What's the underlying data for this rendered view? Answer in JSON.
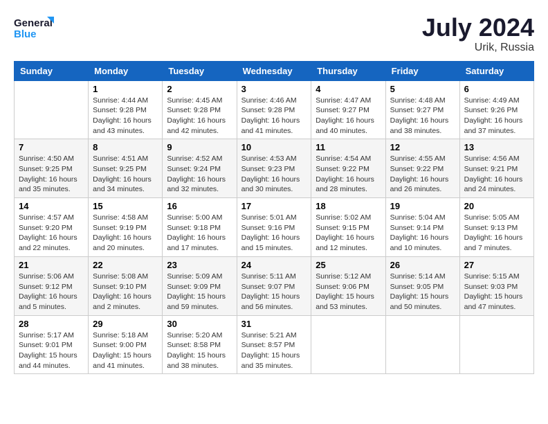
{
  "header": {
    "logo_general": "General",
    "logo_blue": "Blue",
    "month_year": "July 2024",
    "location": "Urik, Russia"
  },
  "days_of_week": [
    "Sunday",
    "Monday",
    "Tuesday",
    "Wednesday",
    "Thursday",
    "Friday",
    "Saturday"
  ],
  "weeks": [
    [
      {
        "day": "",
        "info": ""
      },
      {
        "day": "1",
        "info": "Sunrise: 4:44 AM\nSunset: 9:28 PM\nDaylight: 16 hours\nand 43 minutes."
      },
      {
        "day": "2",
        "info": "Sunrise: 4:45 AM\nSunset: 9:28 PM\nDaylight: 16 hours\nand 42 minutes."
      },
      {
        "day": "3",
        "info": "Sunrise: 4:46 AM\nSunset: 9:28 PM\nDaylight: 16 hours\nand 41 minutes."
      },
      {
        "day": "4",
        "info": "Sunrise: 4:47 AM\nSunset: 9:27 PM\nDaylight: 16 hours\nand 40 minutes."
      },
      {
        "day": "5",
        "info": "Sunrise: 4:48 AM\nSunset: 9:27 PM\nDaylight: 16 hours\nand 38 minutes."
      },
      {
        "day": "6",
        "info": "Sunrise: 4:49 AM\nSunset: 9:26 PM\nDaylight: 16 hours\nand 37 minutes."
      }
    ],
    [
      {
        "day": "7",
        "info": "Sunrise: 4:50 AM\nSunset: 9:25 PM\nDaylight: 16 hours\nand 35 minutes."
      },
      {
        "day": "8",
        "info": "Sunrise: 4:51 AM\nSunset: 9:25 PM\nDaylight: 16 hours\nand 34 minutes."
      },
      {
        "day": "9",
        "info": "Sunrise: 4:52 AM\nSunset: 9:24 PM\nDaylight: 16 hours\nand 32 minutes."
      },
      {
        "day": "10",
        "info": "Sunrise: 4:53 AM\nSunset: 9:23 PM\nDaylight: 16 hours\nand 30 minutes."
      },
      {
        "day": "11",
        "info": "Sunrise: 4:54 AM\nSunset: 9:22 PM\nDaylight: 16 hours\nand 28 minutes."
      },
      {
        "day": "12",
        "info": "Sunrise: 4:55 AM\nSunset: 9:22 PM\nDaylight: 16 hours\nand 26 minutes."
      },
      {
        "day": "13",
        "info": "Sunrise: 4:56 AM\nSunset: 9:21 PM\nDaylight: 16 hours\nand 24 minutes."
      }
    ],
    [
      {
        "day": "14",
        "info": "Sunrise: 4:57 AM\nSunset: 9:20 PM\nDaylight: 16 hours\nand 22 minutes."
      },
      {
        "day": "15",
        "info": "Sunrise: 4:58 AM\nSunset: 9:19 PM\nDaylight: 16 hours\nand 20 minutes."
      },
      {
        "day": "16",
        "info": "Sunrise: 5:00 AM\nSunset: 9:18 PM\nDaylight: 16 hours\nand 17 minutes."
      },
      {
        "day": "17",
        "info": "Sunrise: 5:01 AM\nSunset: 9:16 PM\nDaylight: 16 hours\nand 15 minutes."
      },
      {
        "day": "18",
        "info": "Sunrise: 5:02 AM\nSunset: 9:15 PM\nDaylight: 16 hours\nand 12 minutes."
      },
      {
        "day": "19",
        "info": "Sunrise: 5:04 AM\nSunset: 9:14 PM\nDaylight: 16 hours\nand 10 minutes."
      },
      {
        "day": "20",
        "info": "Sunrise: 5:05 AM\nSunset: 9:13 PM\nDaylight: 16 hours\nand 7 minutes."
      }
    ],
    [
      {
        "day": "21",
        "info": "Sunrise: 5:06 AM\nSunset: 9:12 PM\nDaylight: 16 hours\nand 5 minutes."
      },
      {
        "day": "22",
        "info": "Sunrise: 5:08 AM\nSunset: 9:10 PM\nDaylight: 16 hours\nand 2 minutes."
      },
      {
        "day": "23",
        "info": "Sunrise: 5:09 AM\nSunset: 9:09 PM\nDaylight: 15 hours\nand 59 minutes."
      },
      {
        "day": "24",
        "info": "Sunrise: 5:11 AM\nSunset: 9:07 PM\nDaylight: 15 hours\nand 56 minutes."
      },
      {
        "day": "25",
        "info": "Sunrise: 5:12 AM\nSunset: 9:06 PM\nDaylight: 15 hours\nand 53 minutes."
      },
      {
        "day": "26",
        "info": "Sunrise: 5:14 AM\nSunset: 9:05 PM\nDaylight: 15 hours\nand 50 minutes."
      },
      {
        "day": "27",
        "info": "Sunrise: 5:15 AM\nSunset: 9:03 PM\nDaylight: 15 hours\nand 47 minutes."
      }
    ],
    [
      {
        "day": "28",
        "info": "Sunrise: 5:17 AM\nSunset: 9:01 PM\nDaylight: 15 hours\nand 44 minutes."
      },
      {
        "day": "29",
        "info": "Sunrise: 5:18 AM\nSunset: 9:00 PM\nDaylight: 15 hours\nand 41 minutes."
      },
      {
        "day": "30",
        "info": "Sunrise: 5:20 AM\nSunset: 8:58 PM\nDaylight: 15 hours\nand 38 minutes."
      },
      {
        "day": "31",
        "info": "Sunrise: 5:21 AM\nSunset: 8:57 PM\nDaylight: 15 hours\nand 35 minutes."
      },
      {
        "day": "",
        "info": ""
      },
      {
        "day": "",
        "info": ""
      },
      {
        "day": "",
        "info": ""
      }
    ]
  ]
}
